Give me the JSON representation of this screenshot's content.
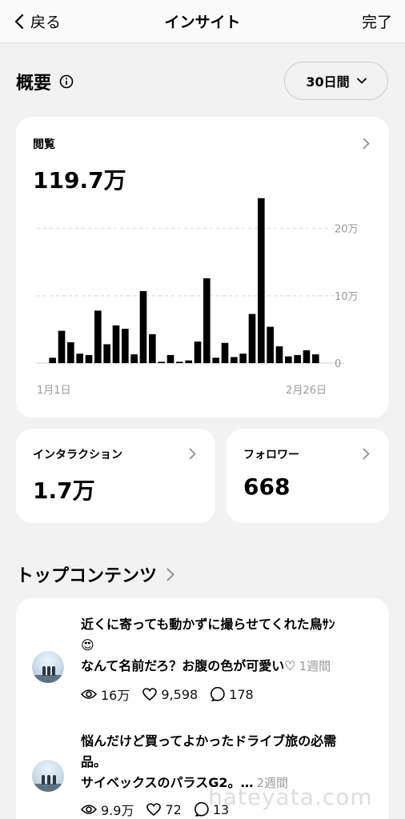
{
  "nav": {
    "back_label": "戻る",
    "title": "インサイト",
    "done_label": "完了"
  },
  "overview": {
    "title": "概要",
    "period_label": "30日間"
  },
  "views_card": {
    "label": "閲覧",
    "value": "119.7万"
  },
  "chart_data": {
    "type": "bar",
    "xlabel": "",
    "ylabel": "",
    "x_tick_labels": [
      "1月1日",
      "2月26日"
    ],
    "y_tick_labels": [
      "0",
      "10万",
      "20万"
    ],
    "ylim": [
      0,
      240000
    ],
    "grid": true,
    "values": [
      8000,
      48000,
      31000,
      14000,
      12000,
      78000,
      28000,
      56000,
      51000,
      13000,
      107000,
      43000,
      2000,
      12000,
      2000,
      4000,
      32000,
      126000,
      8000,
      30000,
      9000,
      14000,
      73000,
      245000,
      54000,
      25000,
      10000,
      12000,
      19000,
      13000
    ],
    "color": "#000000"
  },
  "interaction_card": {
    "label": "インタラクション",
    "value": "1.7万"
  },
  "follower_card": {
    "label": "フォロワー",
    "value": "668"
  },
  "top_contents": {
    "title": "トップコンテンツ",
    "posts": [
      {
        "line1": "近くに寄っても動かずに撮らせてくれた鳥ｻﾝ",
        "line2": "😍",
        "line3": "なんて名前だろ？お腹の色が可愛い♡",
        "age": "1週間",
        "views": "16万",
        "likes": "9,598",
        "comments": "178"
      },
      {
        "line1": "悩んだけど買ってよかったドライブ旅の必需",
        "line2": "品。",
        "line3": "サイベックスのパラスG2。…",
        "age": "2週間",
        "views": "9.9万",
        "likes": "72",
        "comments": "13"
      }
    ]
  },
  "watermark": "hateyata.com",
  "colors": {
    "background": "#f2f2f2",
    "card": "#ffffff",
    "bar": "#000000",
    "muted": "#9a9a9a"
  }
}
